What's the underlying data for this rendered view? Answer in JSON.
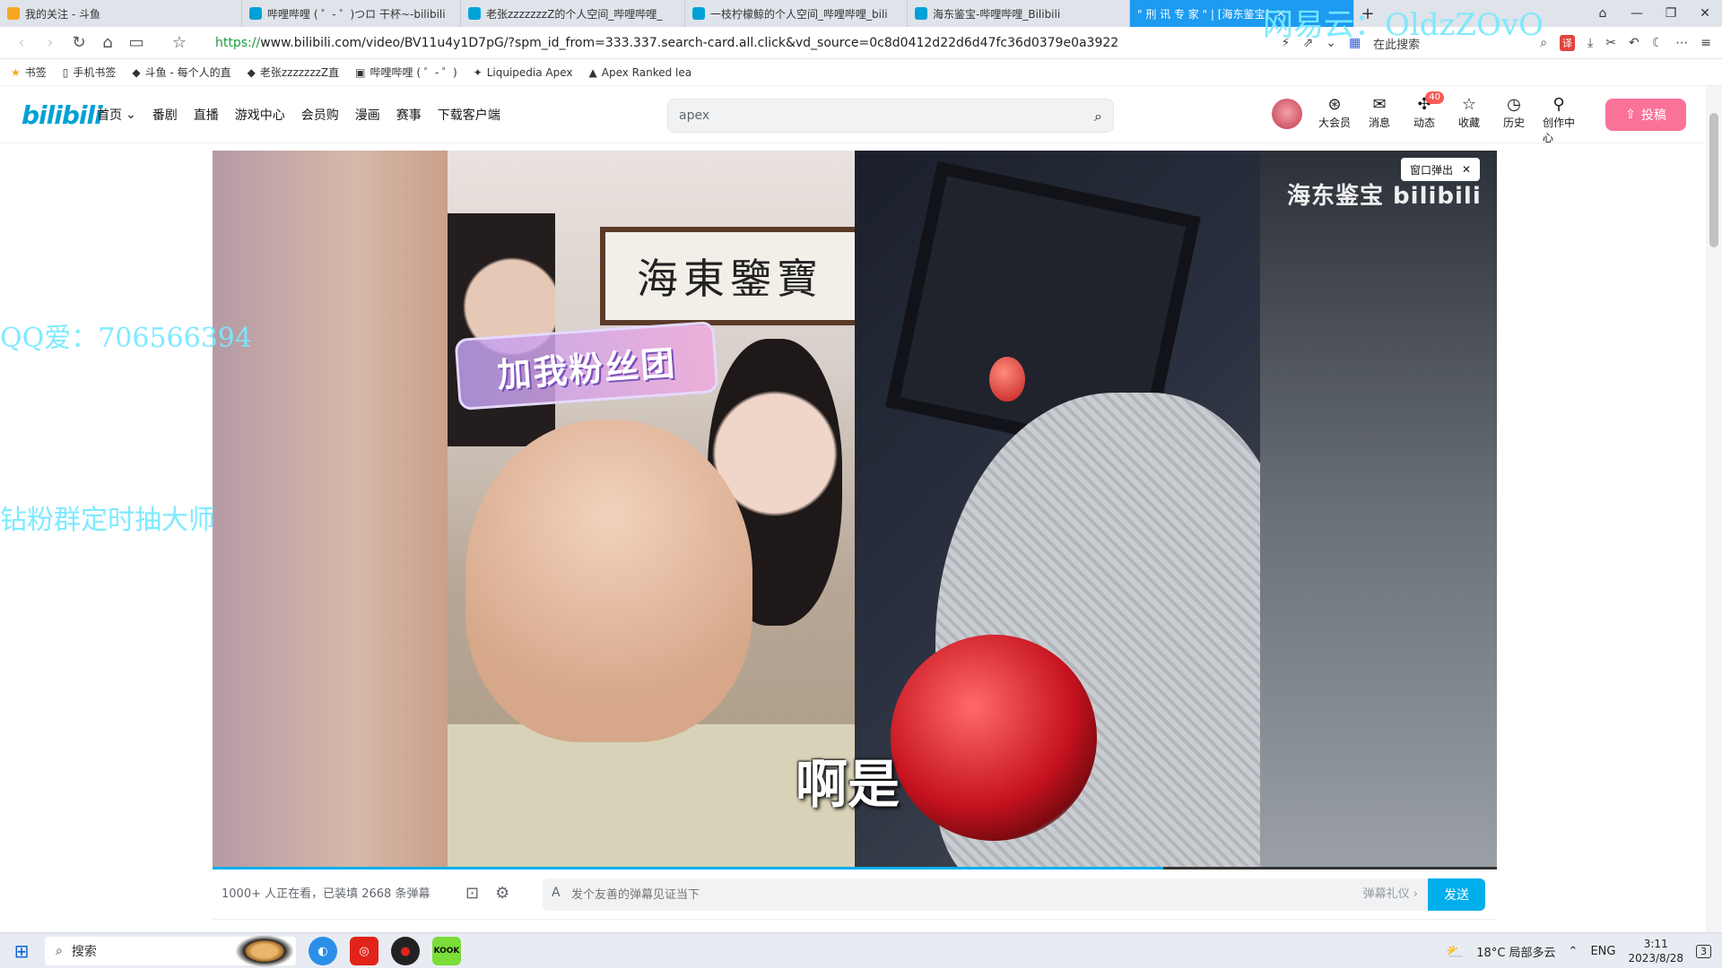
{
  "browser": {
    "tabs": [
      {
        "label": "我的关注 - 斗鱼",
        "color": "#f6a623"
      },
      {
        "label": "哔哩哔哩 ( ゜- ゜)つロ 干杯~-bilibili",
        "color": "#00a1d6"
      },
      {
        "label": "老张zzzzzzzZ的个人空间_哔哩哔哩_",
        "color": "#00a1d6"
      },
      {
        "label": "一枝柠檬鲸的个人空间_哔哩哔哩_bili",
        "color": "#00a1d6"
      },
      {
        "label": "海东鉴宝-哔哩哔哩_Bilibili",
        "color": "#00a1d6"
      },
      {
        "label": "\" 刑 讯 专 家 \" | [海东鉴宝]",
        "color": "#ffffff"
      }
    ],
    "url_proto": "https://",
    "url_rest": "www.bilibili.com/video/BV11u4y1D7pG/?spm_id_from=333.337.search-card.all.click&vd_source=0c8d0412d22d6d47fc36d0379e0a3922",
    "search_here": "在此搜索",
    "bookmarks": [
      {
        "label": "书签",
        "icon": "★"
      },
      {
        "label": "手机书签",
        "icon": "▯"
      },
      {
        "label": "斗鱼 - 每个人的直",
        "icon": "◆"
      },
      {
        "label": "老张zzzzzzzZ直",
        "icon": "◆"
      },
      {
        "label": "哔哩哔哩 ( ゜- ゜)",
        "icon": "▣"
      },
      {
        "label": "Liquipedia Apex",
        "icon": "✦"
      },
      {
        "label": "Apex Ranked lea",
        "icon": "▲"
      }
    ]
  },
  "bili": {
    "logo": "bilibili",
    "nav": [
      "首页",
      "番剧",
      "直播",
      "游戏中心",
      "会员购",
      "漫画",
      "赛事",
      "下载客户端"
    ],
    "search_value": "apex",
    "user_nav": [
      {
        "label": "大会员",
        "icon": "⊛"
      },
      {
        "label": "消息",
        "icon": "✉"
      },
      {
        "label": "动态",
        "icon": "✣",
        "badge": "40"
      },
      {
        "label": "收藏",
        "icon": "☆"
      },
      {
        "label": "历史",
        "icon": "◷"
      },
      {
        "label": "创作中心",
        "icon": "⚲"
      }
    ],
    "upload": "投稿"
  },
  "video": {
    "watermark": "海东鉴宝 bilibili",
    "popout": "窗口弹出",
    "subtitle": "啊是",
    "plaque": "海東鑒寶",
    "fan_badge": "加我粉丝团",
    "progress": 0.74
  },
  "danmaku": {
    "viewers": "1000+ 人正在看，已装填 2668 条弹幕",
    "placeholder": "发个友善的弹幕见证当下",
    "etiquette": "弹幕礼仪 ›",
    "send": "发送"
  },
  "overlays": {
    "qq": "QQ爱：706566394",
    "zuan": "钻粉群定时抽大师",
    "wangyi": "网易云：OldzZOvO"
  },
  "taskbar": {
    "search": "搜索",
    "weather": "18°C 局部多云",
    "lang": "ENG",
    "time": "3:11",
    "date": "2023/8/28",
    "notif": "3"
  }
}
